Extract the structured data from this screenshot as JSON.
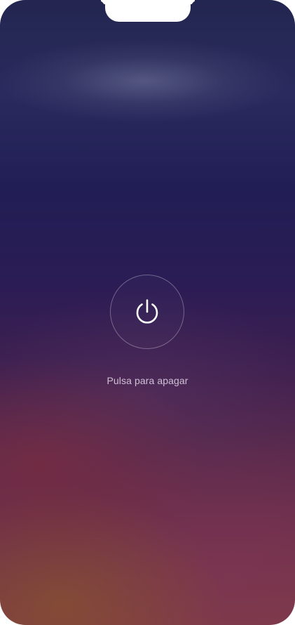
{
  "screen": {
    "name": "power-off-screen"
  },
  "power_button": {
    "icon": "power-icon",
    "hint_text": "Pulsa para apagar"
  },
  "colors": {
    "icon_stroke": "#ffffff",
    "background_top": "#232650",
    "background_bottom": "#7d3a45"
  }
}
